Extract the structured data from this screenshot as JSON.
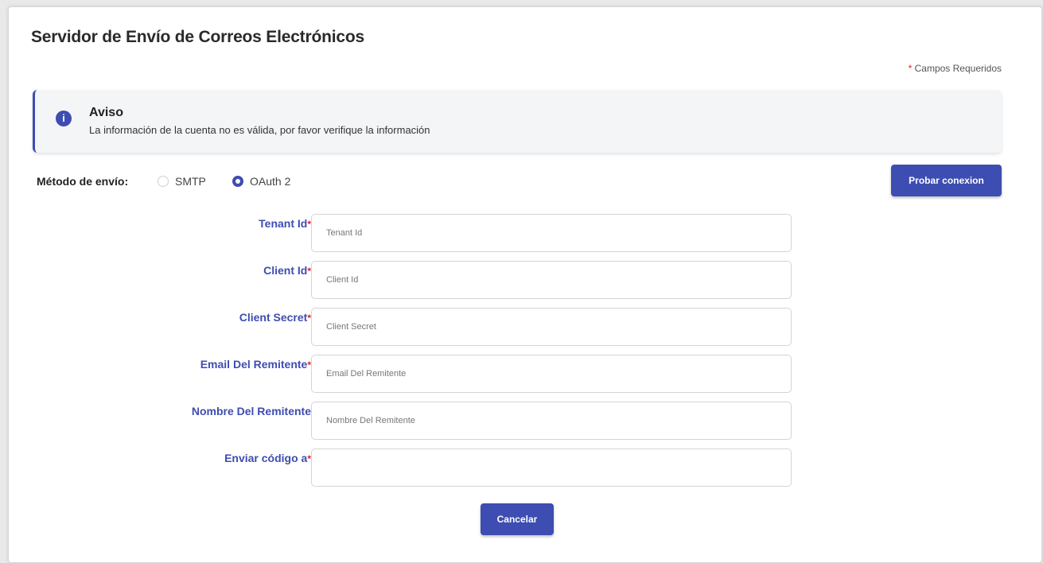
{
  "page": {
    "title": "Servidor de Envío de Correos Electrónicos",
    "required_star": "*",
    "required_note": "Campos Requeridos"
  },
  "notice": {
    "icon": "info-icon",
    "icon_glyph": "i",
    "title": "Aviso",
    "message": "La información de la cuenta no es válida, por favor verifique la información"
  },
  "method": {
    "label": "Método de envío:",
    "options": [
      {
        "label": "SMTP",
        "selected": false
      },
      {
        "label": "OAuth 2",
        "selected": true
      }
    ]
  },
  "buttons": {
    "test_connection": "Probar conexion",
    "cancel": "Cancelar"
  },
  "fields": [
    {
      "label": "Tenant Id",
      "required": "*",
      "placeholder": "Tenant Id",
      "value": ""
    },
    {
      "label": "Client Id",
      "required": "*",
      "placeholder": "Client Id",
      "value": ""
    },
    {
      "label": "Client Secret",
      "required": "*",
      "placeholder": "Client Secret",
      "value": ""
    },
    {
      "label": "Email Del Remitente",
      "required": "*",
      "placeholder": "Email Del Remitente",
      "value": ""
    },
    {
      "label": "Nombre Del Remitente",
      "required": "",
      "placeholder": "Nombre Del Remitente",
      "value": ""
    },
    {
      "label": "Enviar código a",
      "required": "*",
      "placeholder": "",
      "value": ""
    }
  ],
  "colors": {
    "accent": "#3d4db1",
    "required": "#e0202a",
    "notice_background": "#f4f5f7"
  }
}
